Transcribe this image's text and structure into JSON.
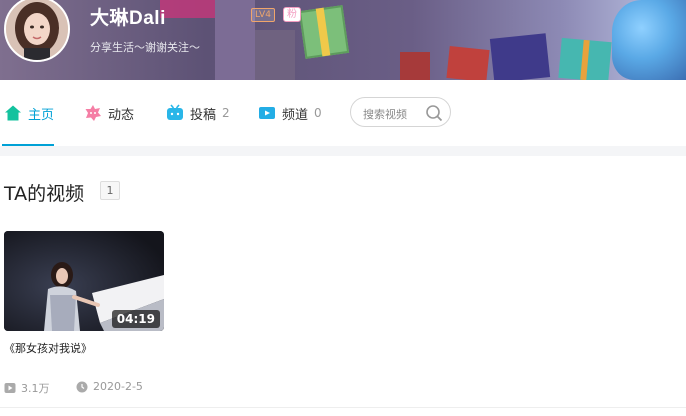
{
  "profile": {
    "username": "大琳Dali",
    "level_badge": "LV4",
    "fan_badge": "粉",
    "signature": "分享生活～谢谢关注～"
  },
  "nav": {
    "items": [
      {
        "label": "主页",
        "icon": "home-icon",
        "count": ""
      },
      {
        "label": "动态",
        "icon": "dynamic-icon",
        "count": ""
      },
      {
        "label": "投稿",
        "icon": "upload-icon",
        "count": "2"
      },
      {
        "label": "频道",
        "icon": "channel-icon",
        "count": "0"
      }
    ],
    "active_index": 0,
    "search_placeholder": "搜索视频"
  },
  "videos_section": {
    "title": "TA的视频",
    "count": "1",
    "items": [
      {
        "title": "《那女孩对我说》",
        "duration": "04:19",
        "plays": "3.1万",
        "date": "2020-2-5"
      }
    ]
  },
  "colors": {
    "accent": "#00a1d6",
    "home_icon": "#13c29e",
    "dynamic_icon": "#f57ea5",
    "upload_icon": "#29b6e8",
    "channel_icon": "#23ade5",
    "meta_text": "#999999"
  }
}
